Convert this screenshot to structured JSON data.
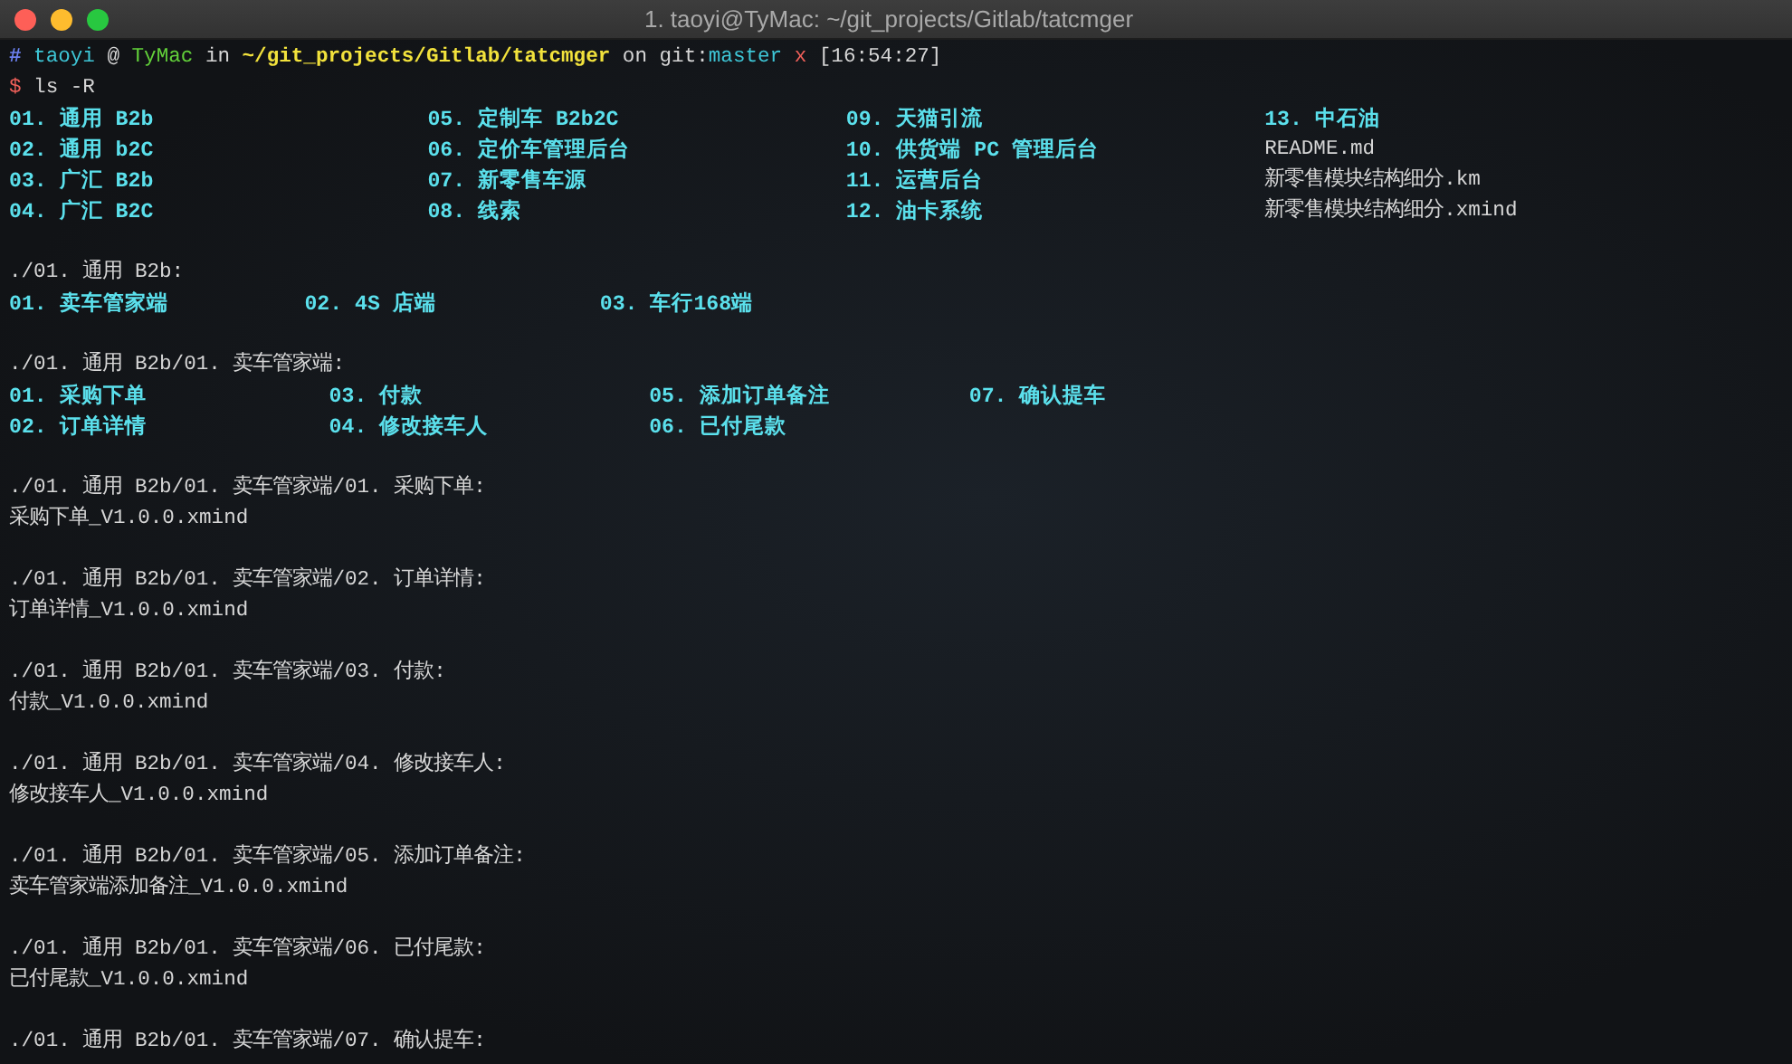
{
  "window": {
    "title": "1. taoyi@TyMac: ~/git_projects/Gitlab/tatcmger"
  },
  "prompt": {
    "hash": "#",
    "user": "taoyi",
    "at": "@",
    "host": "TyMac",
    "in": "in",
    "path": "~/git_projects/Gitlab/tatcmger",
    "on": "on git:",
    "branch": "master",
    "dirty_mark": "x",
    "time": "[16:54:27]"
  },
  "command": {
    "symbol": "$",
    "text": "ls -R"
  },
  "output": [
    {
      "kind": "listing",
      "columns": [
        [
          {
            "name": "01. 通用 B2b",
            "kind": "dir"
          },
          {
            "name": "02. 通用 b2C",
            "kind": "dir"
          },
          {
            "name": "03. 广汇 B2b",
            "kind": "dir"
          },
          {
            "name": "04. 广汇 B2C",
            "kind": "dir"
          }
        ],
        [
          {
            "name": "05. 定制车 B2b2C",
            "kind": "dir"
          },
          {
            "name": "06. 定价车管理后台",
            "kind": "dir"
          },
          {
            "name": "07. 新零售车源",
            "kind": "dir"
          },
          {
            "name": "08. 线索",
            "kind": "dir"
          }
        ],
        [
          {
            "name": "09. 天猫引流",
            "kind": "dir"
          },
          {
            "name": "10. 供货端 PC 管理后台",
            "kind": "dir"
          },
          {
            "name": "11. 运营后台",
            "kind": "dir"
          },
          {
            "name": "12. 油卡系统",
            "kind": "dir"
          }
        ],
        [
          {
            "name": "13. 中石油",
            "kind": "dir"
          },
          {
            "name": "README.md",
            "kind": "file"
          },
          {
            "name": "新零售模块结构细分.km",
            "kind": "file"
          },
          {
            "name": "新零售模块结构细分.xmind",
            "kind": "file"
          }
        ]
      ]
    },
    {
      "kind": "heading",
      "text": "./01. 通用 B2b:"
    },
    {
      "kind": "listing",
      "columns": [
        [
          {
            "name": "01. 卖车管家端",
            "kind": "dir"
          }
        ],
        [
          {
            "name": "02. 4S 店端",
            "kind": "dir"
          }
        ],
        [
          {
            "name": "03. 车行168端",
            "kind": "dir"
          }
        ]
      ]
    },
    {
      "kind": "heading",
      "text": "./01. 通用 B2b/01. 卖车管家端:"
    },
    {
      "kind": "listing",
      "columns": [
        [
          {
            "name": "01. 采购下单",
            "kind": "dir"
          },
          {
            "name": "02. 订单详情",
            "kind": "dir"
          }
        ],
        [
          {
            "name": "03. 付款",
            "kind": "dir"
          },
          {
            "name": "04. 修改接车人",
            "kind": "dir"
          }
        ],
        [
          {
            "name": "05. 添加订单备注",
            "kind": "dir"
          },
          {
            "name": "06. 已付尾款",
            "kind": "dir"
          }
        ],
        [
          {
            "name": "07. 确认提车",
            "kind": "dir"
          }
        ]
      ]
    },
    {
      "kind": "heading",
      "text": "./01. 通用 B2b/01. 卖车管家端/01. 采购下单:"
    },
    {
      "kind": "file",
      "text": "采购下单_V1.0.0.xmind"
    },
    {
      "kind": "heading",
      "text": "./01. 通用 B2b/01. 卖车管家端/02. 订单详情:"
    },
    {
      "kind": "file",
      "text": "订单详情_V1.0.0.xmind"
    },
    {
      "kind": "heading",
      "text": "./01. 通用 B2b/01. 卖车管家端/03. 付款:"
    },
    {
      "kind": "file",
      "text": "付款_V1.0.0.xmind"
    },
    {
      "kind": "heading",
      "text": "./01. 通用 B2b/01. 卖车管家端/04. 修改接车人:"
    },
    {
      "kind": "file",
      "text": "修改接车人_V1.0.0.xmind"
    },
    {
      "kind": "heading",
      "text": "./01. 通用 B2b/01. 卖车管家端/05. 添加订单备注:"
    },
    {
      "kind": "file",
      "text": "卖车管家端添加备注_V1.0.0.xmind"
    },
    {
      "kind": "heading",
      "text": "./01. 通用 B2b/01. 卖车管家端/06. 已付尾款:"
    },
    {
      "kind": "file",
      "text": "已付尾款_V1.0.0.xmind"
    },
    {
      "kind": "heading",
      "text": "./01. 通用 B2b/01. 卖车管家端/07. 确认提车:"
    }
  ]
}
